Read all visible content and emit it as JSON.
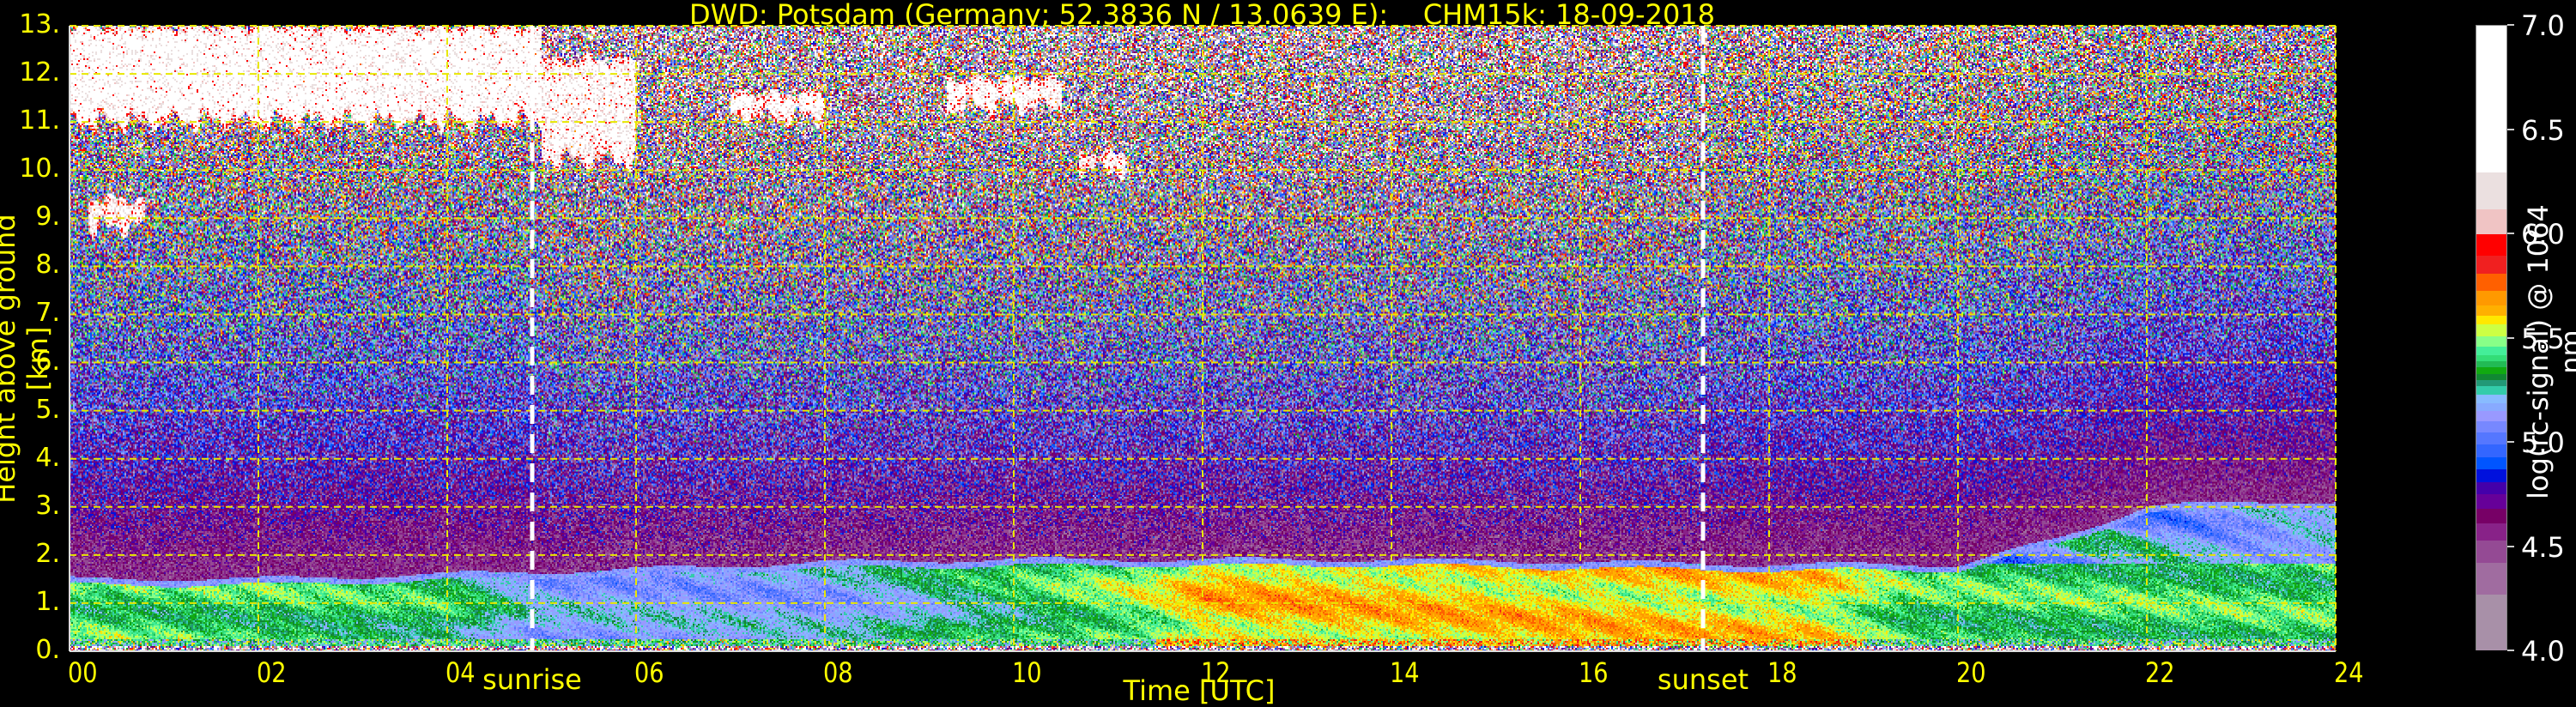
{
  "title": "DWD: Potsdam (Germany; 52.3836 N / 13.0639 E):    CHM15k: 18-09-2018",
  "chart_data": {
    "type": "heatmap",
    "title": "DWD: Potsdam (Germany; 52.3836 N / 13.0639 E):    CHM15k: 18-09-2018",
    "xlabel": "Time [UTC]",
    "ylabel": "Height above ground [km]",
    "xlim": [
      0,
      24
    ],
    "ylim": [
      0,
      13
    ],
    "grid": true,
    "x_ticks": [
      0,
      2,
      4,
      6,
      8,
      10,
      12,
      14,
      16,
      18,
      20,
      22,
      24
    ],
    "x_tick_labels": [
      "00",
      "02",
      "04",
      "06",
      "08",
      "10",
      "12",
      "14",
      "16",
      "18",
      "20",
      "22",
      "24"
    ],
    "y_ticks": [
      0,
      1,
      2,
      3,
      4,
      5,
      6,
      7,
      8,
      9,
      10,
      11,
      12,
      13
    ],
    "y_tick_labels": [
      "0.",
      "1.",
      "2.",
      "3.",
      "4.",
      "5.",
      "6.",
      "7.",
      "8.",
      "9.",
      "10.",
      "11.",
      "12.",
      "13."
    ],
    "annotations": [
      {
        "label": "sunrise",
        "hour": 4.9
      },
      {
        "label": "sunset",
        "hour": 17.3
      }
    ],
    "boundary_layer_top_km": {
      "hours": [
        0,
        2,
        4,
        6,
        8,
        10,
        12,
        14,
        16,
        18,
        19,
        20,
        21,
        22,
        23,
        24
      ],
      "heights": [
        1.5,
        1.5,
        1.6,
        1.7,
        1.85,
        1.9,
        1.9,
        1.9,
        1.85,
        1.8,
        1.8,
        1.8,
        2.3,
        3.0,
        3.1,
        3.1
      ]
    },
    "boundary_layer_signal": {
      "hours": [
        0,
        2,
        4,
        5,
        8,
        10,
        11.5,
        12,
        16,
        18.5,
        19.5,
        24
      ],
      "values": [
        5.42,
        5.4,
        5.35,
        5.15,
        5.15,
        5.35,
        5.5,
        5.62,
        5.6,
        5.58,
        5.4,
        5.4
      ]
    },
    "clouds": [
      {
        "start": 0.0,
        "end": 5.0,
        "base_km": 11.0,
        "top_km": 13.0,
        "signal": 6.6
      },
      {
        "start": 5.0,
        "end": 6.0,
        "base_km": 10.2,
        "top_km": 12.3,
        "signal": 6.5
      },
      {
        "start": 7.0,
        "end": 8.0,
        "base_km": 11.1,
        "top_km": 11.6,
        "signal": 6.5
      },
      {
        "start": 9.3,
        "end": 10.5,
        "base_km": 11.3,
        "top_km": 11.9,
        "signal": 6.5
      },
      {
        "start": 10.7,
        "end": 11.2,
        "base_km": 10.0,
        "top_km": 10.35,
        "signal": 6.4
      },
      {
        "start": 0.2,
        "end": 0.8,
        "base_km": 8.8,
        "top_km": 9.4,
        "signal": 6.4
      }
    ],
    "colorbar": {
      "label": "log(rc-signal) @ 1064 nm",
      "range": [
        4.0,
        7.0
      ],
      "ticks": [
        "4.0",
        "4.5",
        "5.0",
        "5.5",
        "6.0",
        "6.5",
        "7.0"
      ],
      "bands": [
        {
          "from": 4.0,
          "to": 4.27,
          "color": "#a890a8"
        },
        {
          "from": 4.27,
          "to": 4.42,
          "color": "#a06ca0"
        },
        {
          "from": 4.42,
          "to": 4.53,
          "color": "#944a94"
        },
        {
          "from": 4.53,
          "to": 4.61,
          "color": "#882288"
        },
        {
          "from": 4.61,
          "to": 4.68,
          "color": "#770066"
        },
        {
          "from": 4.68,
          "to": 4.75,
          "color": "#660099"
        },
        {
          "from": 4.75,
          "to": 4.81,
          "color": "#4400aa"
        },
        {
          "from": 4.81,
          "to": 4.87,
          "color": "#0011dd"
        },
        {
          "from": 4.87,
          "to": 4.93,
          "color": "#0055ff"
        },
        {
          "from": 4.93,
          "to": 4.99,
          "color": "#3366ff"
        },
        {
          "from": 4.99,
          "to": 5.05,
          "color": "#5577ff"
        },
        {
          "from": 5.05,
          "to": 5.1,
          "color": "#7788ff"
        },
        {
          "from": 5.1,
          "to": 5.15,
          "color": "#9999ff"
        },
        {
          "from": 5.15,
          "to": 5.19,
          "color": "#88aaff"
        },
        {
          "from": 5.19,
          "to": 5.23,
          "color": "#88bbff"
        },
        {
          "from": 5.23,
          "to": 5.27,
          "color": "#33ccaa"
        },
        {
          "from": 5.27,
          "to": 5.3,
          "color": "#229977"
        },
        {
          "from": 5.3,
          "to": 5.33,
          "color": "#118833"
        },
        {
          "from": 5.33,
          "to": 5.36,
          "color": "#11aa11"
        },
        {
          "from": 5.36,
          "to": 5.39,
          "color": "#22bb55"
        },
        {
          "from": 5.39,
          "to": 5.42,
          "color": "#33dd77"
        },
        {
          "from": 5.42,
          "to": 5.46,
          "color": "#44ee99"
        },
        {
          "from": 5.46,
          "to": 5.51,
          "color": "#88ff88"
        },
        {
          "from": 5.51,
          "to": 5.57,
          "color": "#ccff44"
        },
        {
          "from": 5.57,
          "to": 5.61,
          "color": "#ffe800"
        },
        {
          "from": 5.61,
          "to": 5.66,
          "color": "#ffb000"
        },
        {
          "from": 5.66,
          "to": 5.73,
          "color": "#ff9900"
        },
        {
          "from": 5.73,
          "to": 5.81,
          "color": "#ff6000"
        },
        {
          "from": 5.81,
          "to": 5.9,
          "color": "#f02020"
        },
        {
          "from": 5.9,
          "to": 6.0,
          "color": "#ff0000"
        },
        {
          "from": 6.0,
          "to": 6.12,
          "color": "#f0c4c4"
        },
        {
          "from": 6.12,
          "to": 6.3,
          "color": "#ebe0e0"
        },
        {
          "from": 6.3,
          "to": 7.0,
          "color": "#ffffff"
        }
      ]
    }
  }
}
